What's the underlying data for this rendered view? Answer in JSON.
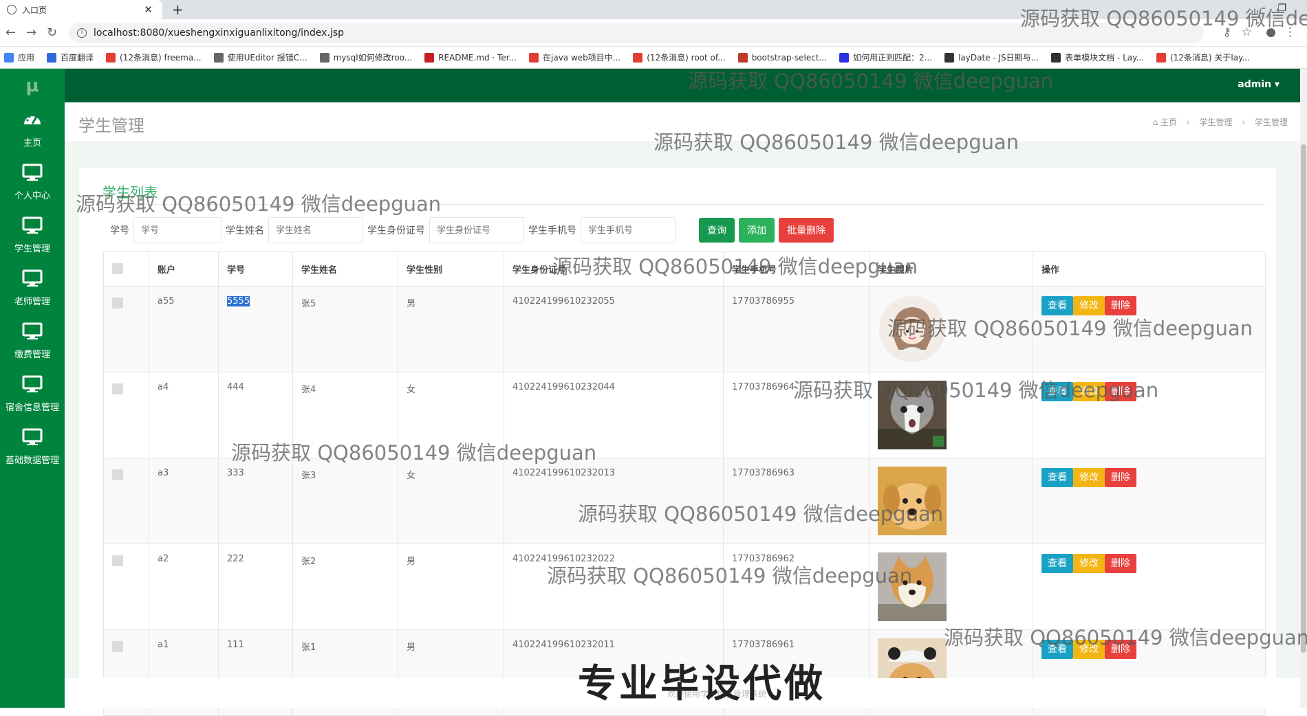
{
  "browser": {
    "tab_title": "入口页",
    "url": "localhost:8080/xueshengxinxiguanlixitong/index.jsp",
    "bookmarks": [
      {
        "label": "应用",
        "icon": "apps-icon",
        "color": "#4285f4"
      },
      {
        "label": "百度翻译",
        "icon": "baidu-translate-icon",
        "color": "#2d6bd9"
      },
      {
        "label": "(12条消息) freema...",
        "icon": "csdn-icon",
        "color": "#e33e33"
      },
      {
        "label": "使用UEditor 报错C...",
        "icon": "link-icon",
        "color": "#666666"
      },
      {
        "label": "mysql如何修改roo...",
        "icon": "link-icon",
        "color": "#666666"
      },
      {
        "label": "README.md · Ter...",
        "icon": "gitee-icon",
        "color": "#c71d23"
      },
      {
        "label": "在java web项目中...",
        "icon": "csdn-icon",
        "color": "#e33e33"
      },
      {
        "label": "(12条消息) root of...",
        "icon": "csdn-icon",
        "color": "#e33e33"
      },
      {
        "label": "bootstrap-select...",
        "icon": "doc-icon",
        "color": "#c0392b"
      },
      {
        "label": "如何用正则匹配：2...",
        "icon": "baidu-icon",
        "color": "#2932e1"
      },
      {
        "label": "layDate - JS日期与...",
        "icon": "layui-icon",
        "color": "#333333"
      },
      {
        "label": "表单模块文档 - Lay...",
        "icon": "layui-icon",
        "color": "#333333"
      },
      {
        "label": "(12条消息) 关于lay...",
        "icon": "csdn-icon",
        "color": "#e33e33"
      }
    ]
  },
  "app": {
    "logo": "μ",
    "user": "admin",
    "sidebar": [
      {
        "label": "主页",
        "icon": "dashboard-icon"
      },
      {
        "label": "个人中心",
        "icon": "monitor-icon"
      },
      {
        "label": "学生管理",
        "icon": "monitor-icon"
      },
      {
        "label": "老师管理",
        "icon": "monitor-icon"
      },
      {
        "label": "缴费管理",
        "icon": "monitor-icon"
      },
      {
        "label": "宿舍信息管理",
        "icon": "monitor-icon"
      },
      {
        "label": "基础数据管理",
        "icon": "monitor-icon"
      }
    ],
    "page_title": "学生管理",
    "breadcrumb": [
      "主页",
      "学生管理",
      "学生管理"
    ],
    "panel_title": "学生列表",
    "search": {
      "fields": [
        {
          "label": "学号",
          "placeholder": "学号"
        },
        {
          "label": "学生姓名",
          "placeholder": "学生姓名"
        },
        {
          "label": "学生身份证号",
          "placeholder": "学生身份证号"
        },
        {
          "label": "学生手机号",
          "placeholder": "学生手机号"
        }
      ],
      "query_button": "查询",
      "add_button": "添加",
      "batch_delete_button": "批量删除"
    },
    "table": {
      "columns": [
        "账户",
        "学号",
        "学生姓名",
        "学生性别",
        "学生身份证号",
        "学生手机号",
        "学生照片",
        "操作"
      ],
      "rows": [
        {
          "account": "a55",
          "student_no": "5555",
          "name": "张5",
          "gender": "男",
          "id_card": "410224199610232055",
          "phone": "17703786955",
          "photo": "girl-avatar"
        },
        {
          "account": "a4",
          "student_no": "444",
          "name": "张4",
          "gender": "女",
          "id_card": "410224199610232044",
          "phone": "17703786964",
          "photo": "cat"
        },
        {
          "account": "a3",
          "student_no": "333",
          "name": "张3",
          "gender": "女",
          "id_card": "410224199610232013",
          "phone": "17703786963",
          "photo": "puppy"
        },
        {
          "account": "a2",
          "student_no": "222",
          "name": "张2",
          "gender": "男",
          "id_card": "410224199610232022",
          "phone": "17703786962",
          "photo": "shiba"
        },
        {
          "account": "a1",
          "student_no": "111",
          "name": "张1",
          "gender": "男",
          "id_card": "410224199610232011",
          "phone": "17703786961",
          "photo": "dog-hat"
        }
      ],
      "actions": {
        "view": "查看",
        "edit": "修改",
        "delete": "删除"
      }
    },
    "footer": "欢迎使用学生信息管理系统"
  },
  "overlay": {
    "watermark": "源码获取 QQ86050149 微信deepguan",
    "banner": "专业毕设代做"
  },
  "colors": {
    "sidebar": "#00843d",
    "topbar": "#005f32",
    "accent": "#38b06a",
    "view_btn": "#1aa2c4",
    "edit_btn": "#f3b512",
    "delete_btn": "#e8403c"
  }
}
